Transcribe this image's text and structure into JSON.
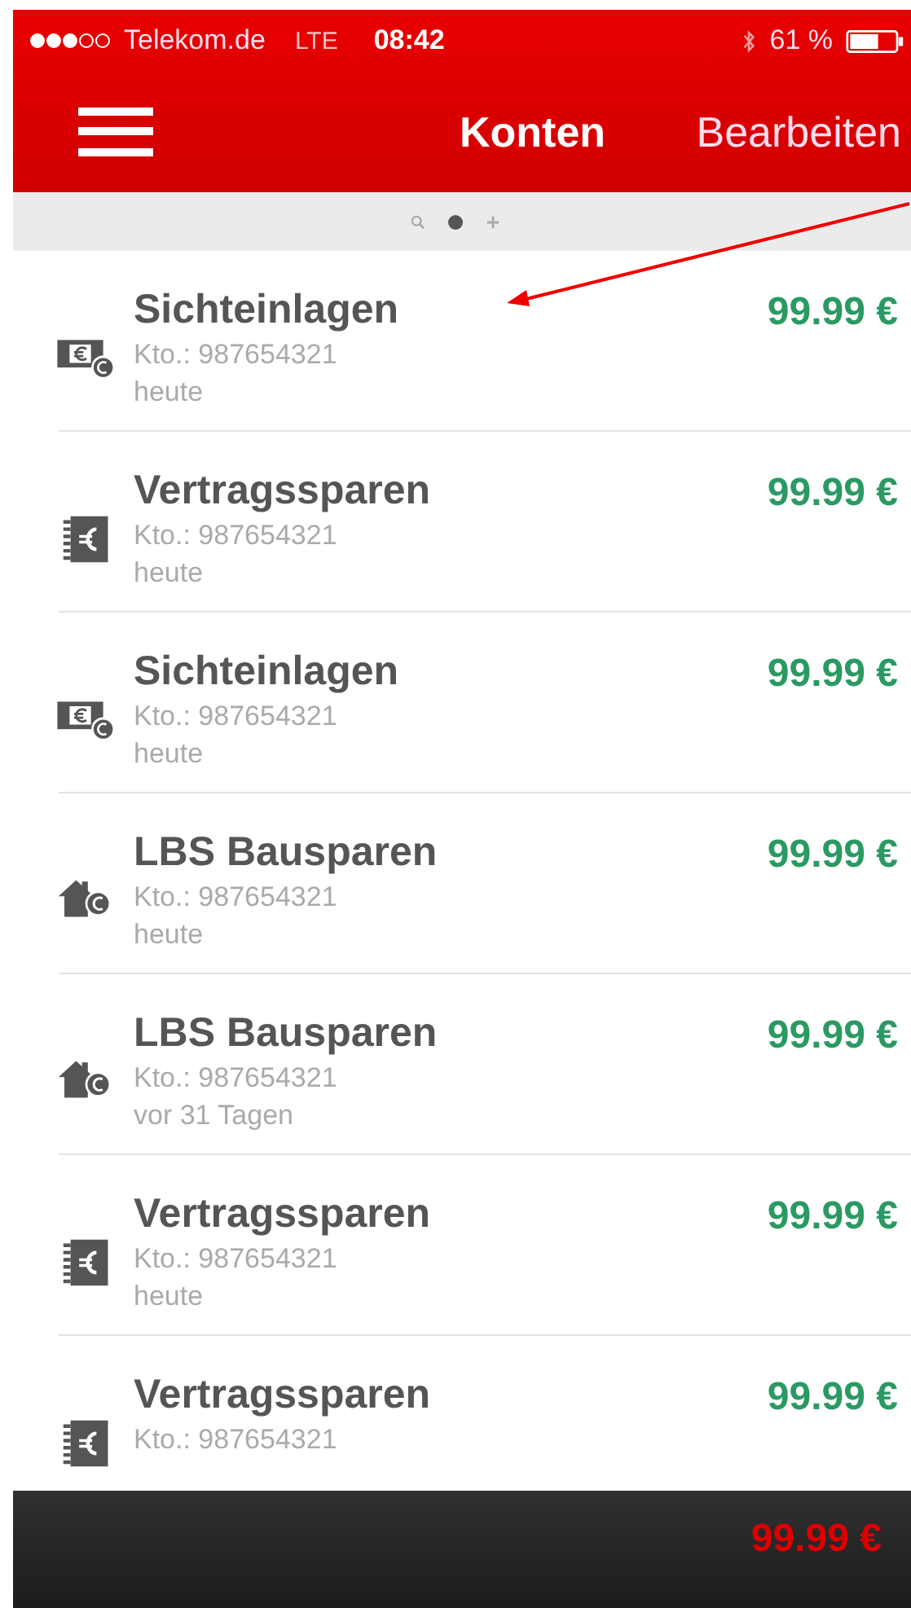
{
  "status_bar": {
    "carrier": "Telekom.de",
    "network": "LTE",
    "time": "08:42",
    "battery": "61 %"
  },
  "nav_bar": {
    "title": "Konten",
    "action": "Bearbeiten"
  },
  "page_indicator": [
    {
      "kind": "search",
      "selected": false
    },
    {
      "kind": "dot",
      "selected": true
    },
    {
      "kind": "plus",
      "selected": false
    }
  ],
  "accounts": [
    {
      "kind": "cash",
      "name": "Sichteinlagen",
      "number": "Kto.: 987654321",
      "date": "heute",
      "amount": "99.99 €"
    },
    {
      "kind": "book",
      "name": "Vertragssparen",
      "number": "Kto.: 987654321",
      "date": "heute",
      "amount": "99.99 €"
    },
    {
      "kind": "cash",
      "name": "Sichteinlagen",
      "number": "Kto.: 987654321",
      "date": "heute",
      "amount": "99.99 €"
    },
    {
      "kind": "house",
      "name": "LBS Bausparen",
      "number": "Kto.: 987654321",
      "date": "heute",
      "amount": "99.99 €"
    },
    {
      "kind": "house",
      "name": "LBS Bausparen",
      "number": "Kto.: 987654321",
      "date": "vor 31 Tagen",
      "amount": "99.99 €"
    },
    {
      "kind": "book",
      "name": "Vertragssparen",
      "number": "Kto.: 987654321",
      "date": "heute",
      "amount": "99.99 €"
    },
    {
      "kind": "book",
      "name": "Vertragssparen",
      "number": "Kto.: 987654321",
      "amount": "99.99 €"
    }
  ],
  "total_bar": {
    "amount": "99.99 €"
  }
}
